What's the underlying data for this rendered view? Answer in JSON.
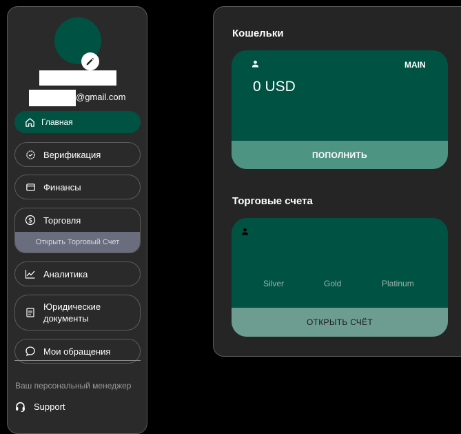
{
  "profile": {
    "email_suffix": "@gmail.com"
  },
  "nav": {
    "home": "Главная",
    "verification": "Верификация",
    "finance": "Финансы",
    "trading": "Торговля",
    "trading_sub": "Открыть Торговый Счет",
    "analytics": "Аналитика",
    "legal": "Юридические\nдокументы",
    "tickets": "Мои обращения"
  },
  "manager": {
    "title": "Ваш персональный менеджер",
    "support": "Support"
  },
  "wallets": {
    "title": "Кошельки",
    "badge": "MAIN",
    "balance": "0 USD",
    "button": "ПОПОЛНИТЬ"
  },
  "accounts": {
    "title": "Торговые счета",
    "tiers": [
      "Silver",
      "Gold",
      "Platinum"
    ],
    "button": "ОТКРЫТЬ СЧЁТ"
  },
  "colors": {
    "accent": "#005243",
    "wallet_button": "#4e9482",
    "account_button": "#6d9c90",
    "trade_sub": "#6a6d7e"
  },
  "icons": {
    "home": "home-icon",
    "verification": "badge-check-icon",
    "finance": "wallet-icon",
    "trading": "dollar-circle-icon",
    "analytics": "chart-line-icon",
    "legal": "document-icon",
    "tickets": "chat-bubble-icon",
    "support": "headset-icon",
    "edit": "pencil-icon",
    "user": "user-icon"
  }
}
